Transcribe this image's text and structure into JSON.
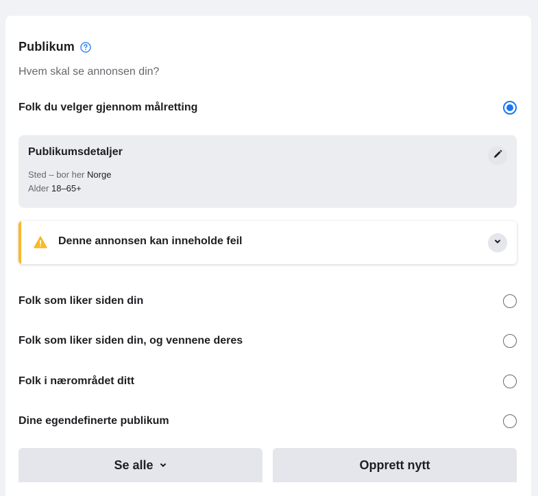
{
  "audience": {
    "title": "Publikum",
    "subtitle": "Hvem skal se annonsen din?",
    "help_icon": "question-circle-icon",
    "accent_color": "#1877f2"
  },
  "options": [
    {
      "label": "Folk du velger gjennom målretting",
      "selected": true
    },
    {
      "label": "Folk som liker siden din",
      "selected": false
    },
    {
      "label": "Folk som liker siden din, og vennene deres",
      "selected": false
    },
    {
      "label": "Folk i nærområdet ditt",
      "selected": false
    },
    {
      "label": "Dine egendefinerte publikum",
      "selected": false
    }
  ],
  "details": {
    "title": "Publikumsdetaljer",
    "location_label": "Sted – bor her",
    "location_value": "Norge",
    "age_label": "Alder",
    "age_value": "18–65+",
    "edit_icon": "pencil-icon"
  },
  "warning": {
    "text": "Denne annonsen kan inneholde feil",
    "icon": "warning-triangle-icon",
    "color": "#f7b928"
  },
  "buttons": {
    "see_all": "Se alle",
    "create_new": "Opprett nytt"
  }
}
